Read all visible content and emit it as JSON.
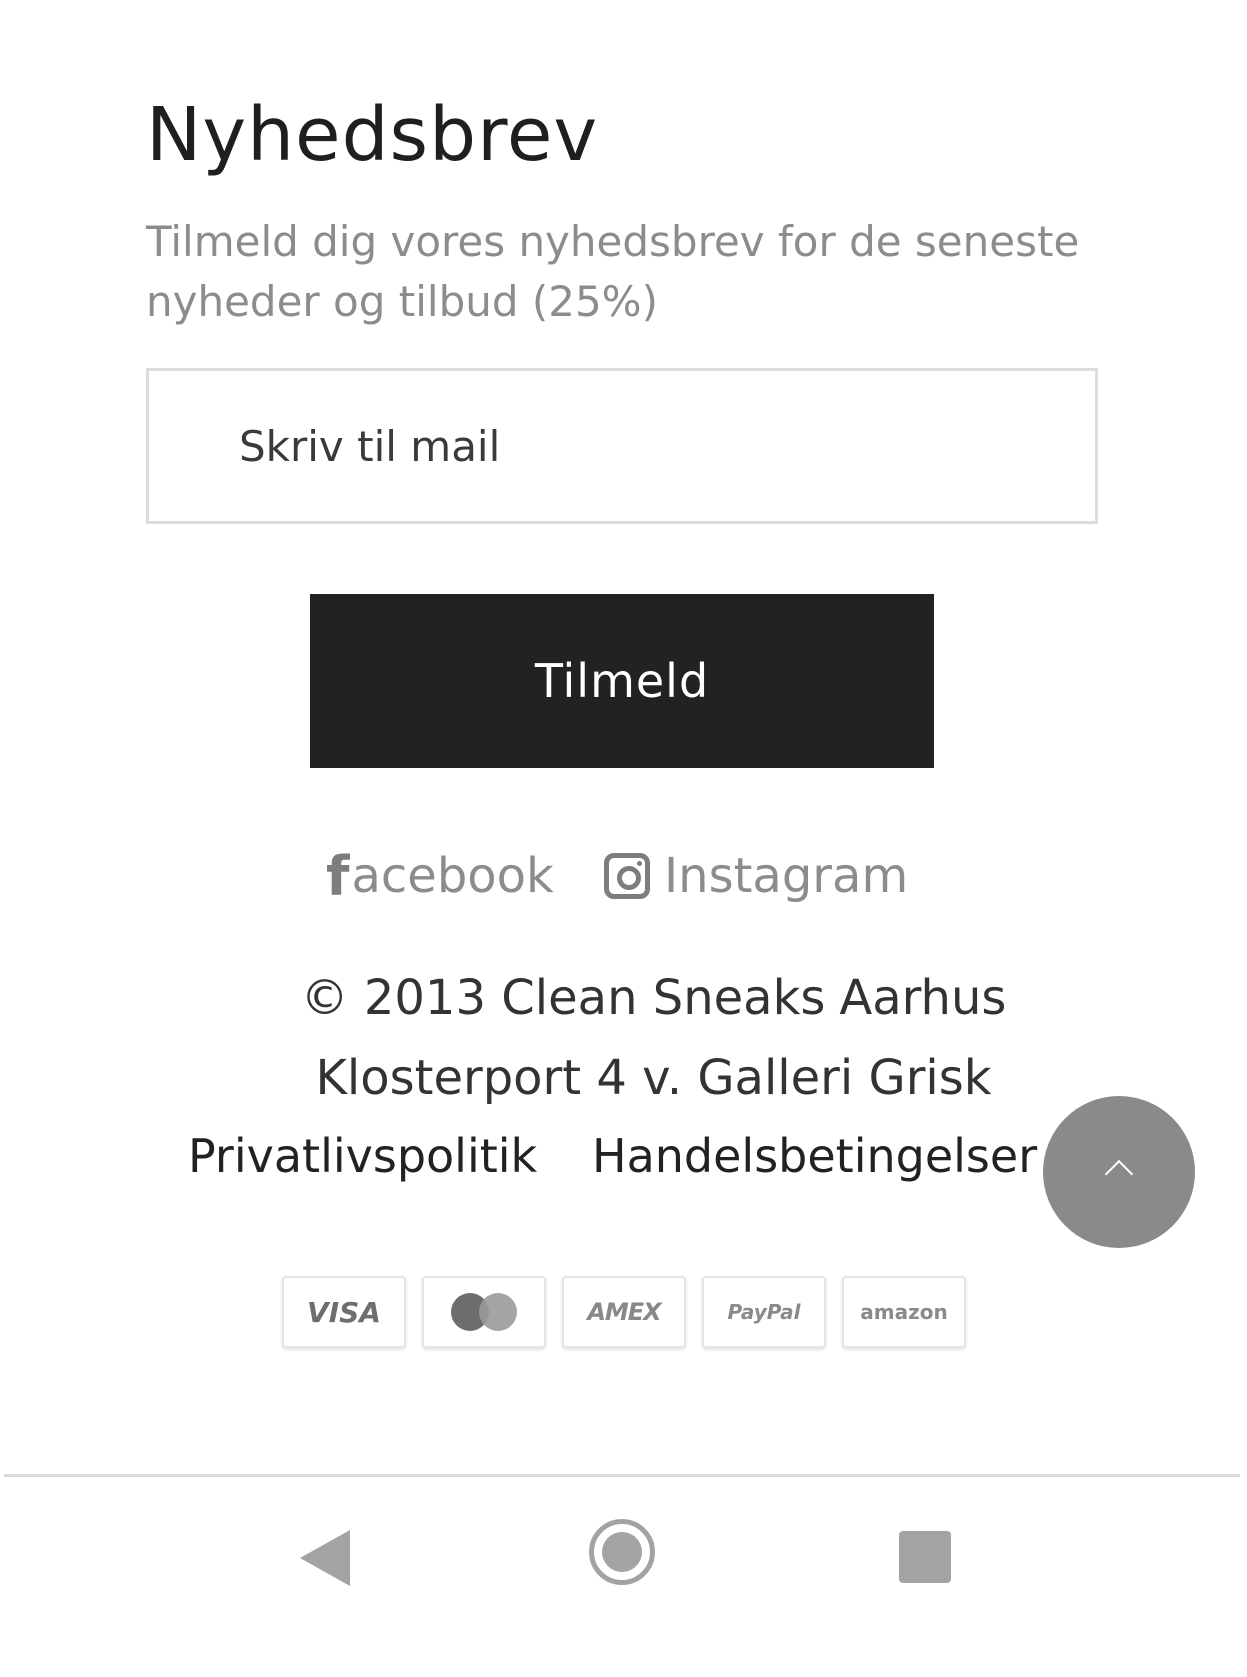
{
  "newsletter": {
    "title": "Nyhedsbrev",
    "description": "Tilmeld dig vores nyhedsbrev for de seneste nyheder og tilbud (25%)",
    "email_placeholder": "Skriv til mail",
    "submit_label": "Tilmeld"
  },
  "social": {
    "facebook_glyph": "f",
    "facebook_label": "acebook",
    "instagram_label": "Instagram"
  },
  "footer": {
    "copyright": "© 2013 Clean Sneaks",
    "city": "Aarhus",
    "address": "Klosterport 4 v. Galleri Grisk",
    "privacy_label": "Privatlivspolitik",
    "terms_label": "Handelsbetingelser"
  },
  "payments": [
    {
      "name": "visa",
      "label": "VISA"
    },
    {
      "name": "mastercard",
      "label": "mastercard"
    },
    {
      "name": "amex",
      "label": "AMEX"
    },
    {
      "name": "paypal",
      "label": "PayPal"
    },
    {
      "name": "amazon",
      "label": "amazon"
    }
  ],
  "colors": {
    "button_bg": "#222222",
    "scroll_top_bg": "#8a8a8a",
    "muted_text": "#8c8c8c",
    "nav_icons": "#a3a3a3"
  },
  "icons": {
    "scroll_top": "chevron-up-icon",
    "facebook": "facebook-icon",
    "instagram": "instagram-icon",
    "nav_back": "back-triangle-icon",
    "nav_home": "home-circle-icon",
    "nav_recents": "recents-square-icon"
  }
}
